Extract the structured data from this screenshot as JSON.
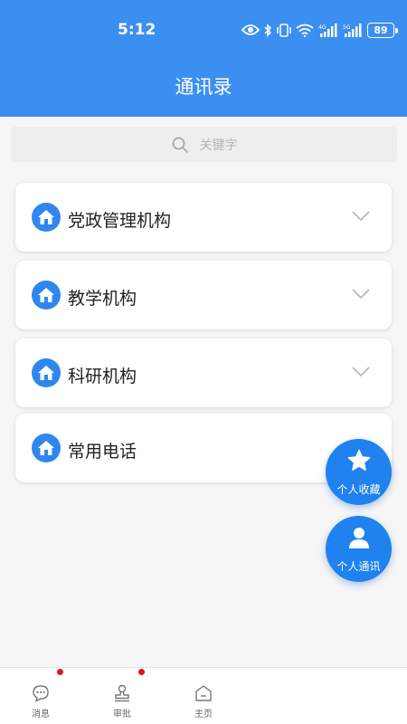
{
  "status_bar": {
    "time": "5:12",
    "battery": "89",
    "icons": [
      "eye-icon",
      "bluetooth-icon",
      "vibrate-icon",
      "wifi-icon",
      "4g-signal-icon",
      "5g-signal-icon"
    ]
  },
  "header": {
    "title": "通讯录",
    "color": "#3b8ff0"
  },
  "search": {
    "placeholder": "关键字"
  },
  "groups": [
    {
      "label": "党政管理机构",
      "expandable": true
    },
    {
      "label": "教学机构",
      "expandable": true
    },
    {
      "label": "科研机构",
      "expandable": true
    },
    {
      "label": "常用电话",
      "expandable": false
    }
  ],
  "fabs": {
    "favorites": {
      "label": "个人收藏",
      "icon": "star-icon"
    },
    "contacts": {
      "label": "个人通讯",
      "icon": "person-icon"
    }
  },
  "tabbar": {
    "items": [
      {
        "label": "消息",
        "icon": "chat-bubble-icon",
        "badge": true
      },
      {
        "label": "审批",
        "icon": "stamp-icon",
        "badge": true
      },
      {
        "label": "主页",
        "icon": "home-icon",
        "badge": false
      }
    ],
    "badge_color": "#d9161c"
  }
}
